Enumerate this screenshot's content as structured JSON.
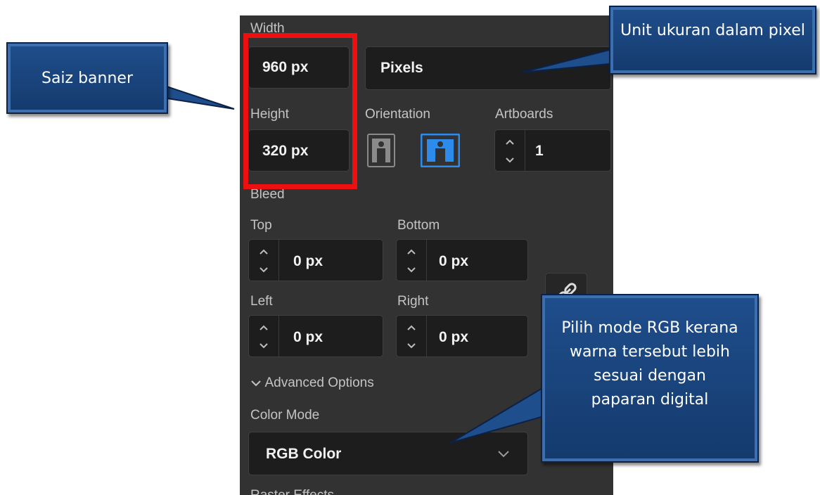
{
  "panel": {
    "width_label": "Width",
    "width_value": "960 px",
    "units_value": "Pixels",
    "height_label": "Height",
    "height_value": "320 px",
    "orientation_label": "Orientation",
    "artboards_label": "Artboards",
    "artboards_value": "1",
    "bleed_label": "Bleed",
    "top_label": "Top",
    "top_value": "0 px",
    "bottom_label": "Bottom",
    "bottom_value": "0 px",
    "left_label": "Left",
    "left_value": "0 px",
    "right_label": "Right",
    "right_value": "0 px",
    "advanced_label": "Advanced Options",
    "color_mode_label": "Color Mode",
    "color_mode_value": "RGB Color",
    "raster_label": "Raster Effects"
  },
  "callouts": {
    "size": "Saiz banner",
    "unit": "Unit ukuran dalam pixel",
    "rgb": "Pilih mode RGB kerana warna tersebut lebih sesuai dengan paparan digital"
  },
  "colors": {
    "panel_bg": "#323232",
    "field_bg": "#1d1d1d",
    "highlight": "#ee1010",
    "callout_blue": "#1f4e8c",
    "orientation_active": "#2d8ceb"
  }
}
